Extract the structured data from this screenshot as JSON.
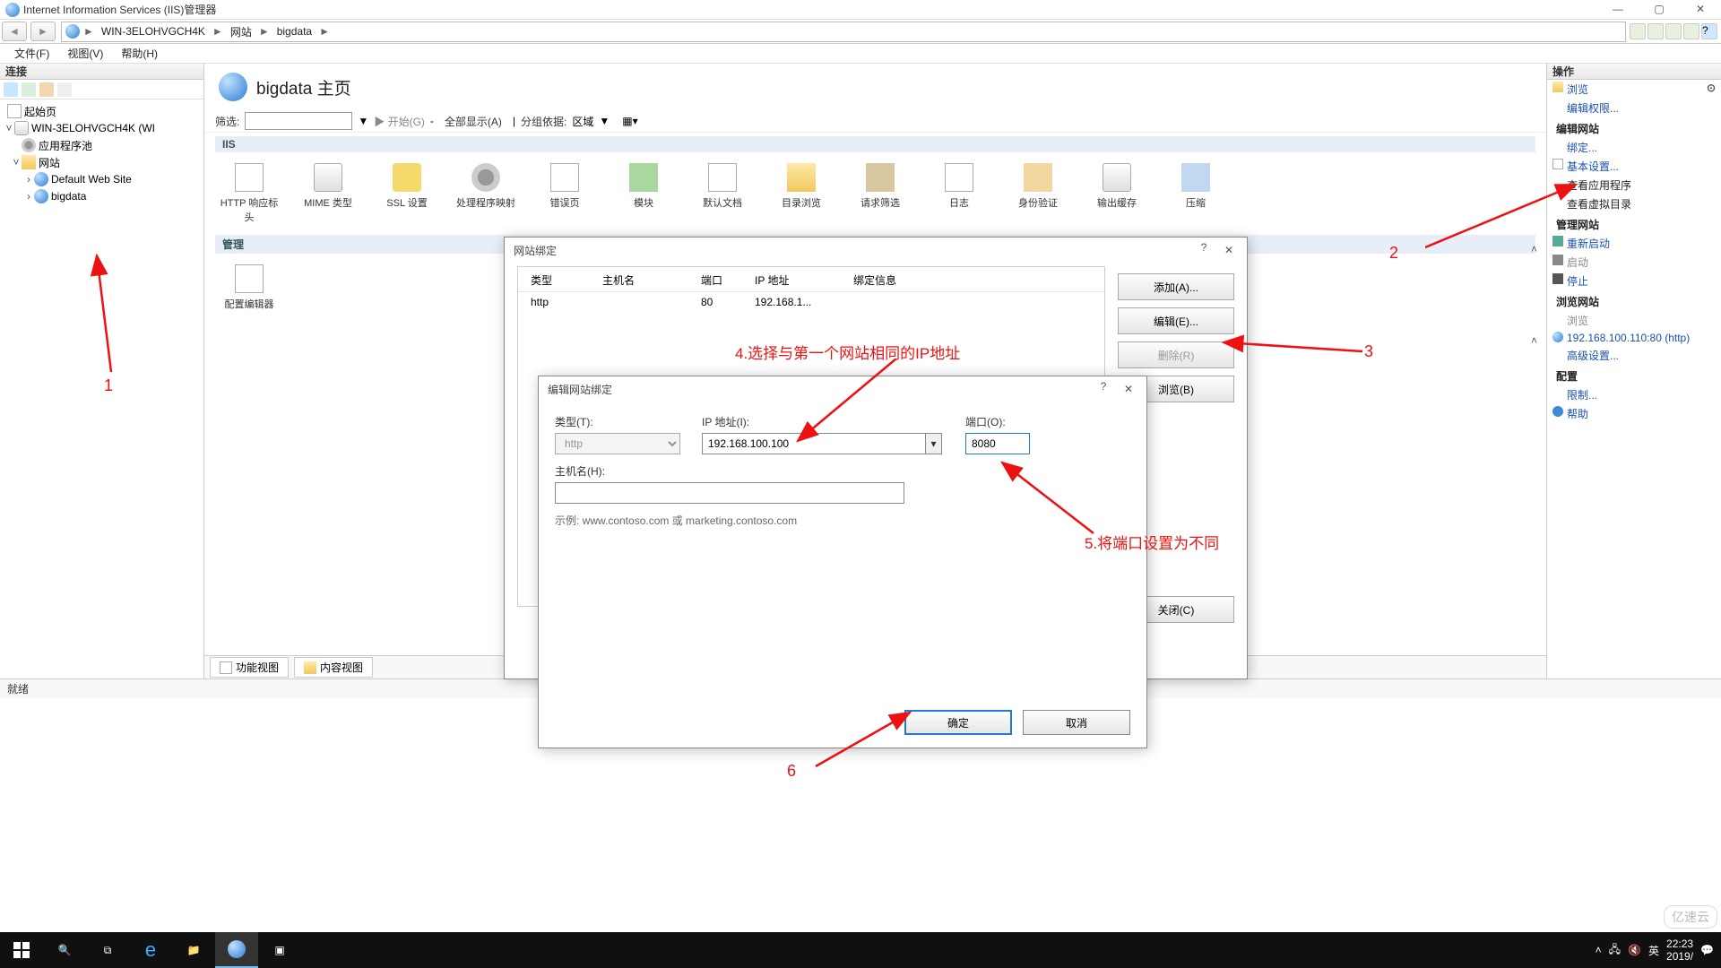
{
  "window": {
    "title": "Internet Information Services (IIS)管理器"
  },
  "breadcrumbs": {
    "root": "WIN-3ELOHVGCH4K",
    "sites": "网站",
    "site": "bigdata"
  },
  "menu": {
    "file": "文件(F)",
    "view": "视图(V)",
    "help": "帮助(H)"
  },
  "sidepanel": {
    "title": "连接"
  },
  "tree": {
    "start": "起始页",
    "server": "WIN-3ELOHVGCH4K (WI",
    "apppools": "应用程序池",
    "sites": "网站",
    "defaultsite": "Default Web Site",
    "bigdata": "bigdata"
  },
  "center": {
    "title": "bigdata 主页",
    "filterLabel": "筛选:",
    "go": "开始(G)",
    "showall": "全部显示(A)",
    "groupby": "分组依据:",
    "groupbyval": "区域",
    "iisGroup": "IIS",
    "manageGroup": "管理",
    "features": {
      "http": "HTTP 响应标头",
      "mime": "MIME 类型",
      "ssl": "SSL 设置",
      "handler": "处理程序映射",
      "err": "错误页",
      "mod": "模块",
      "auth": "默认文档",
      "dir": "目录浏览",
      "req": "请求筛选",
      "log": "日志",
      "authn": "身份验证",
      "out": "输出缓存",
      "comp": "压缩",
      "cfged": "配置编辑器"
    },
    "tabs": {
      "features": "功能视图",
      "content": "内容视图"
    }
  },
  "actions": {
    "title": "操作",
    "browse": "浏览",
    "editPerm": "编辑权限...",
    "editSite": "编辑网站",
    "bindings": "绑定...",
    "basic": "基本设置...",
    "viewApps": "查看应用程序",
    "viewVdir": "查看虚拟目录",
    "manageSite": "管理网站",
    "restart": "重新启动",
    "start": "启动",
    "stop": "停止",
    "browseSite": "浏览网站",
    "browseBtn": "浏览",
    "siteUrl": "192.168.100.110:80 (http)",
    "advanced": "高级设置...",
    "config": "配置",
    "limits": "限制...",
    "help": "帮助"
  },
  "bindingsDialog": {
    "title": "网站绑定",
    "cols": {
      "type": "类型",
      "host": "主机名",
      "port": "端口",
      "ip": "IP 地址",
      "info": "绑定信息"
    },
    "row": {
      "type": "http",
      "host": "",
      "port": "80",
      "ip": "192.168.1..."
    },
    "btns": {
      "add": "添加(A)...",
      "edit": "编辑(E)...",
      "remove": "删除(R)",
      "browse": "浏览(B)",
      "close": "关闭(C)"
    }
  },
  "editDialog": {
    "title": "编辑网站绑定",
    "typeLabel": "类型(T):",
    "typeValue": "http",
    "ipLabel": "IP 地址(I):",
    "ipValue": "192.168.100.100",
    "portLabel": "端口(O):",
    "portValue": "8080",
    "hostLabel": "主机名(H):",
    "hostValue": "",
    "hint": "示例: www.contoso.com 或 marketing.contoso.com",
    "ok": "确定",
    "cancel": "取消"
  },
  "annotations": {
    "a1": "1",
    "a2": "2",
    "a3": "3",
    "a6": "6",
    "a4": "4.选择与第一个网站相同的IP地址",
    "a5": "5.将端口设置为不同"
  },
  "status": {
    "ready": "就绪"
  },
  "taskbar": {
    "ime": "英",
    "time": "22:23",
    "date": "2019/"
  },
  "watermark": "亿速云"
}
